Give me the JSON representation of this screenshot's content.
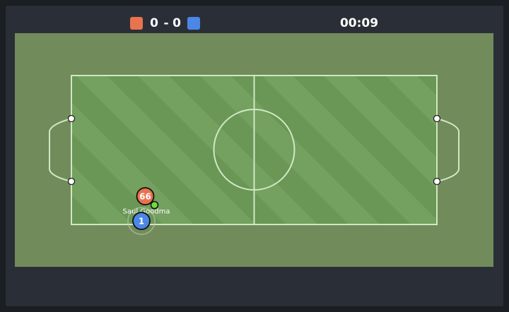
{
  "scoreboard": {
    "red_score": "0",
    "separator": "-",
    "blue_score": "0",
    "clock": "00:09",
    "red_color": "#e8734f",
    "blue_color": "#4b87e6"
  },
  "field": {
    "outer_color": "#718b5b",
    "pitch_color_light": "#74a060",
    "pitch_color_dark": "#6a9656",
    "line_color": "#cfe9c2"
  },
  "players": [
    {
      "team": "red",
      "number": "66",
      "name": ""
    },
    {
      "team": "blue",
      "number": "1",
      "name": "Saul Goodma"
    }
  ],
  "ball": {
    "color": "#6fdc38"
  }
}
